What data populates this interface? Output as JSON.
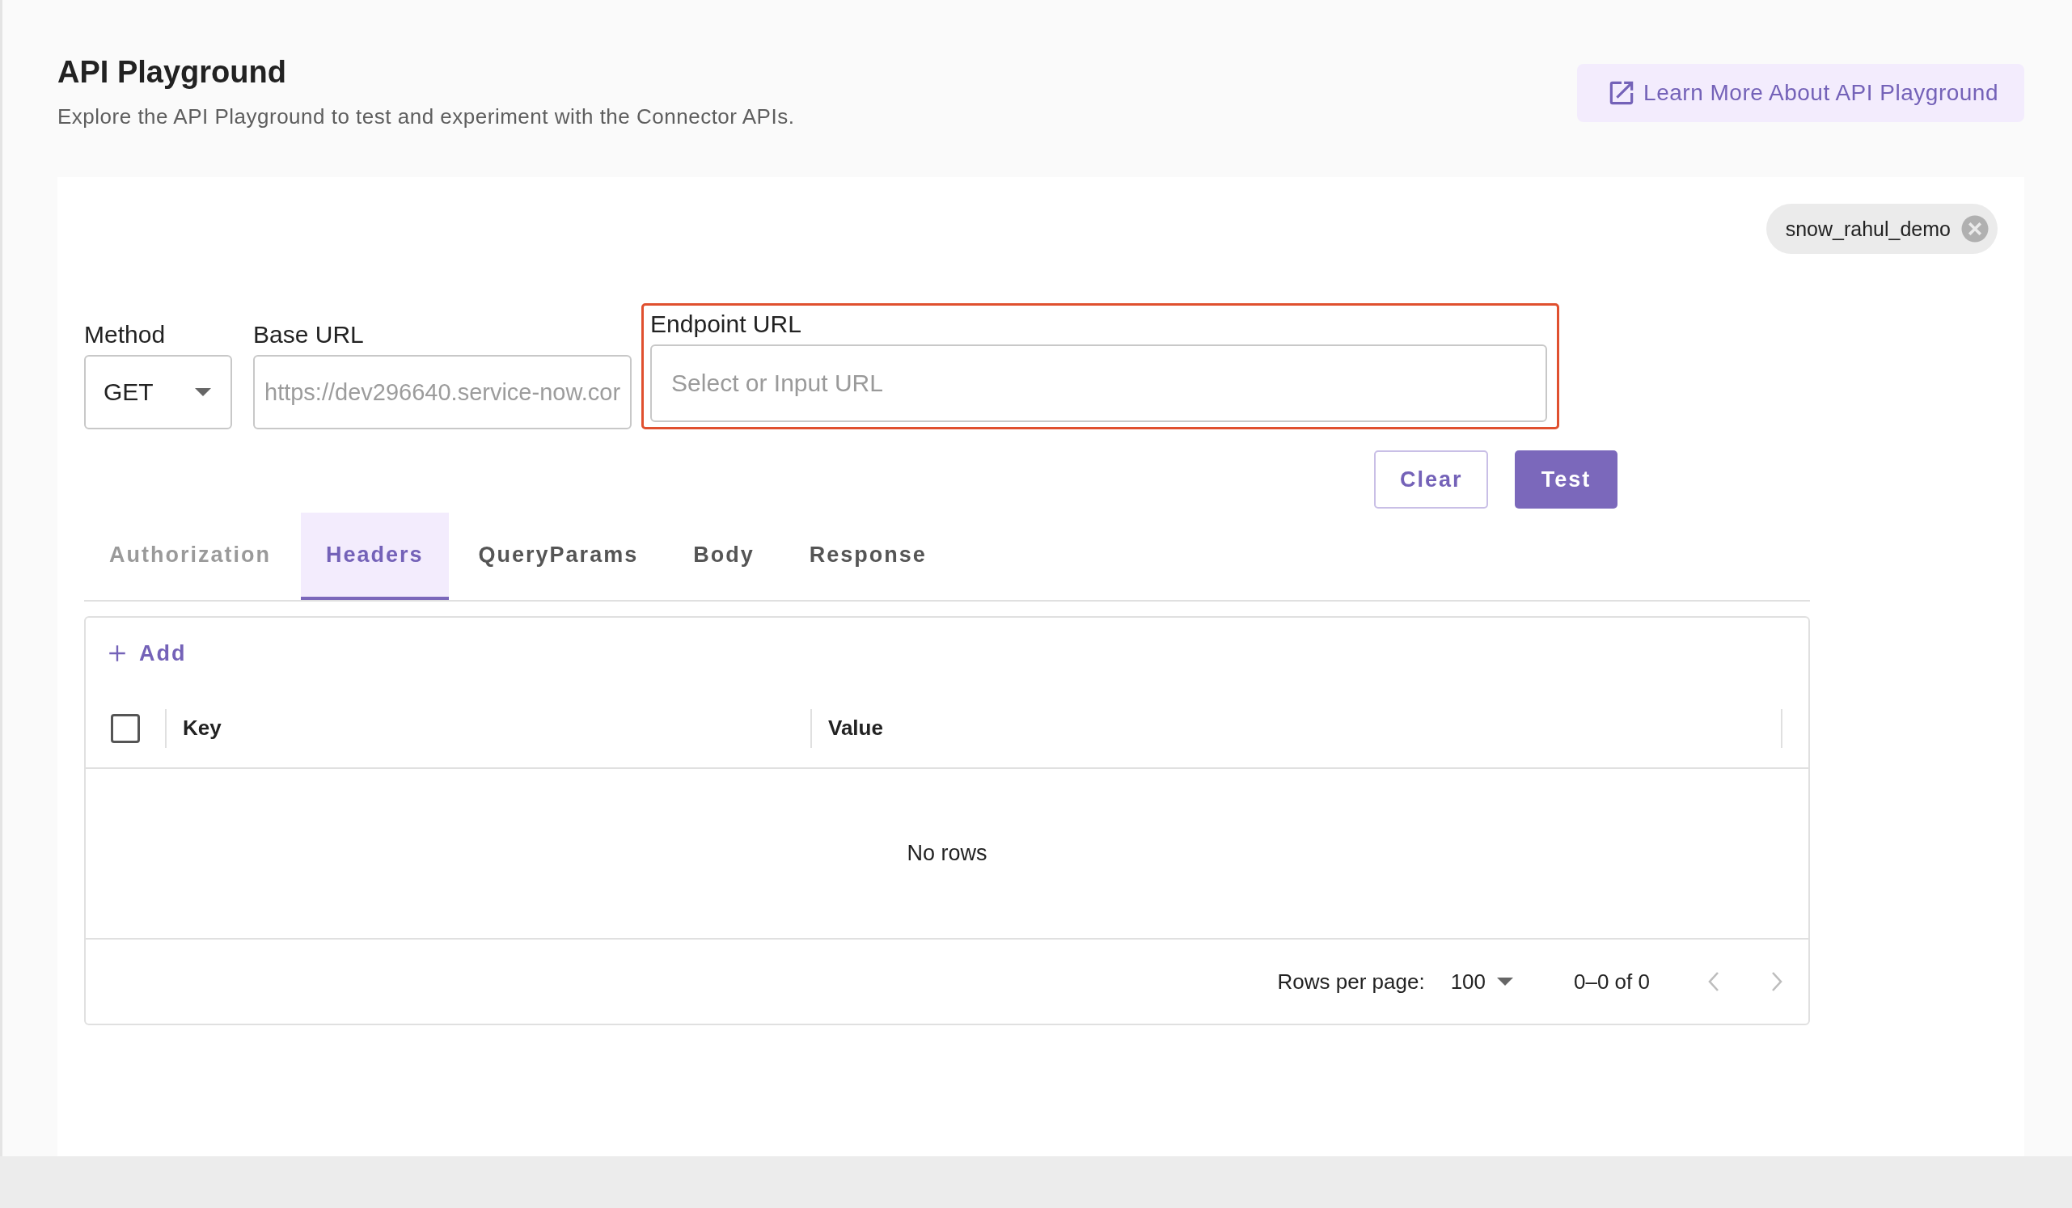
{
  "header": {
    "title": "API Playground",
    "subtitle": "Explore the API Playground to test and experiment with the Connector APIs.",
    "learn_more_button": "Learn More About API Playground"
  },
  "connection_chip": {
    "label": "snow_rahul_demo"
  },
  "form": {
    "method": {
      "label": "Method",
      "value": "GET"
    },
    "base_url": {
      "label": "Base URL",
      "value": "https://dev296640.service-now.cor",
      "disabled": true
    },
    "endpoint_url": {
      "label": "Endpoint URL",
      "placeholder": "Select or Input URL",
      "highlighted": true
    }
  },
  "buttons": [
    {
      "label": "Clear",
      "kind": "outlined"
    },
    {
      "label": "Test",
      "kind": "contained"
    }
  ],
  "tabs": [
    {
      "label": "Authorization",
      "selected": false,
      "disabled": true
    },
    {
      "label": "Headers",
      "selected": true,
      "disabled": false
    },
    {
      "label": "QueryParams",
      "selected": false,
      "disabled": false
    },
    {
      "label": "Body",
      "selected": false,
      "disabled": false
    },
    {
      "label": "Response",
      "selected": false,
      "disabled": false
    }
  ],
  "headers_table": {
    "add_label": "Add",
    "select_all_checked": false,
    "columns": [
      "Key",
      "Value"
    ],
    "empty_text": "No rows",
    "rows_per_page_label": "Rows per page:",
    "rows_per_page": "100",
    "range": "0–0 of 0"
  }
}
